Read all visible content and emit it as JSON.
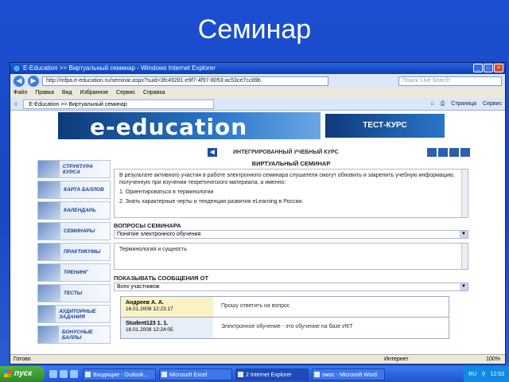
{
  "slide": {
    "title": "Семинар"
  },
  "window": {
    "title": "E-Education >> Виртуальный семинар - Windows Internet Explorer",
    "address": "http://mfpa.e-education.ru/seminar.aspx?suid=3fc49281-e9f7-4f97-8053-ac53ce7cc89b",
    "search_placeholder": "Поиск 'Live Search'",
    "menu": [
      "Файл",
      "Правка",
      "Вид",
      "Избранное",
      "Сервис",
      "Справка"
    ],
    "tab_title": "E-Education >> Виртуальный семинар",
    "tools": [
      "Страница",
      "Сервис"
    ],
    "status": "Готово",
    "zone": "Интернет",
    "zoom": "100%"
  },
  "page": {
    "banner": "e-education",
    "test_course": "ТЕСТ-КУРС",
    "course_title": "ИНТЕГРИРОВАННЫЙ УЧЕБНЫЙ КУРС",
    "sidebar": [
      "СТРУКТУРА КУРСА",
      "КАРТА БАЛЛОВ",
      "КАЛЕНДАРЬ",
      "СЕМИНАРЫ",
      "ПРАКТИКУМЫ",
      "ТРЕНИНГ",
      "ТЕСТЫ",
      "АУДИТОРНЫЕ ЗАДАНИЯ",
      "БОНУСНЫЕ БАЛЛЫ"
    ],
    "seminar_title": "ВИРТУАЛЬНЫЙ СЕМИНАР",
    "seminar_text": [
      "В результате активного участия в работе электронного семинара слушатели смогут обновить и закрепить учебную информацию, полученную при изучении теоретического материала, а именно:",
      "1. Ориентироваться в терминологии",
      "2. Знать характерные черты и тенденции развития eLearning в России."
    ],
    "questions_label": "ВОПРОСЫ СЕМИНАРА",
    "question_selected": "Понятие электронного обучения",
    "question_text": "Терминология и сущность",
    "show_label": "ПОКАЗЫВАТЬ СООБЩЕНИЯ ОТ",
    "show_selected": "Всех участников",
    "messages": [
      {
        "author": "Андреев А. А.",
        "date": "16.01.2008 12:23:17",
        "text": "Прошу ответить на вопрос"
      },
      {
        "author": "Student123 1. 1.",
        "date": "16.01.2008 12:24:05",
        "text": "Электронное обучение - это обучение на базе ИКТ"
      }
    ]
  },
  "taskbar": {
    "start": "пуск",
    "tasks": [
      "Входящие - Outlook...",
      "Microsoft Excel",
      "2 Internet Explorer",
      "эмос - Microsoft Word"
    ],
    "lang": "RU",
    "time": "12:53"
  }
}
